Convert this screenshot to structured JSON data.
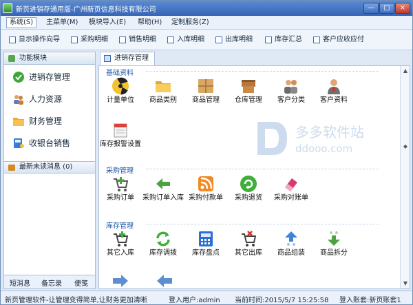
{
  "window": {
    "title": "新页进销存通用版-广州新页信息科技有限公司",
    "minimize": "—",
    "maximize": "□",
    "close": "×"
  },
  "menu": [
    "系统(S)",
    "主菜单(M)",
    "模块导入(E)",
    "帮助(H)",
    "定制服务(Z)"
  ],
  "toolbar": [
    "显示操作向导",
    "采购明细",
    "销售明细",
    "入库明细",
    "出库明细",
    "库存汇总",
    "客户应收应付"
  ],
  "sidebar": {
    "title": "功能模块",
    "items": [
      {
        "label": "进销存管理",
        "icon": "check-circle-icon"
      },
      {
        "label": "人力资源",
        "icon": "people-icon"
      },
      {
        "label": "财务管理",
        "icon": "folder-icon"
      },
      {
        "label": "收银台销售",
        "icon": "cash-register-icon"
      }
    ],
    "messages": "最新未读消息 (0)",
    "footer": [
      "短消息",
      "备忘录",
      "便笺"
    ]
  },
  "tab": {
    "label": "进销存管理"
  },
  "sections": [
    {
      "title": "基础资料",
      "tiles": [
        {
          "label": "计量单位",
          "icon": "radiation-icon"
        },
        {
          "label": "商品类别",
          "icon": "folder-icon"
        },
        {
          "label": "商品管理",
          "icon": "box-icon"
        },
        {
          "label": "仓库管理",
          "icon": "warehouse-boxes-icon"
        },
        {
          "label": "客户分类",
          "icon": "users-group-icon"
        },
        {
          "label": "客户资料",
          "icon": "user-icon"
        },
        {
          "label": "库存报警设置",
          "icon": "calendar-alert-icon"
        }
      ]
    },
    {
      "title": "采购管理",
      "tiles": [
        {
          "label": "采购订单",
          "icon": "cart-add-icon"
        },
        {
          "label": "采购订单入库",
          "icon": "arrow-left-icon"
        },
        {
          "label": "采购付款单",
          "icon": "rss-icon"
        },
        {
          "label": "采购退货",
          "icon": "recycle-icon"
        },
        {
          "label": "采购对账单",
          "icon": "eraser-icon"
        }
      ]
    },
    {
      "title": "库存管理",
      "tiles": [
        {
          "label": "其它入库",
          "icon": "cart-plus-icon"
        },
        {
          "label": "库存调拨",
          "icon": "refresh-icon"
        },
        {
          "label": "库存盘点",
          "icon": "calculator-icon"
        },
        {
          "label": "其它出库",
          "icon": "cart-remove-icon"
        },
        {
          "label": "商品组装",
          "icon": "arrow-up-icon"
        },
        {
          "label": "商品拆分",
          "icon": "arrow-down-icon"
        }
      ]
    }
  ],
  "watermark": {
    "brand": "多多软件站",
    "url": "ddooo.com"
  },
  "status": {
    "slogan": "新页管理软件-让管理变得简单,让财务更加清晰",
    "user": "登入用户:admin",
    "time": "当前时间:2015/5/7 15:25:58",
    "account": "登入账套:新页账套1"
  },
  "colors": {
    "title_bar": "#3f6fbe",
    "accent": "#1d54a8",
    "panel": "#dfe9f6"
  }
}
